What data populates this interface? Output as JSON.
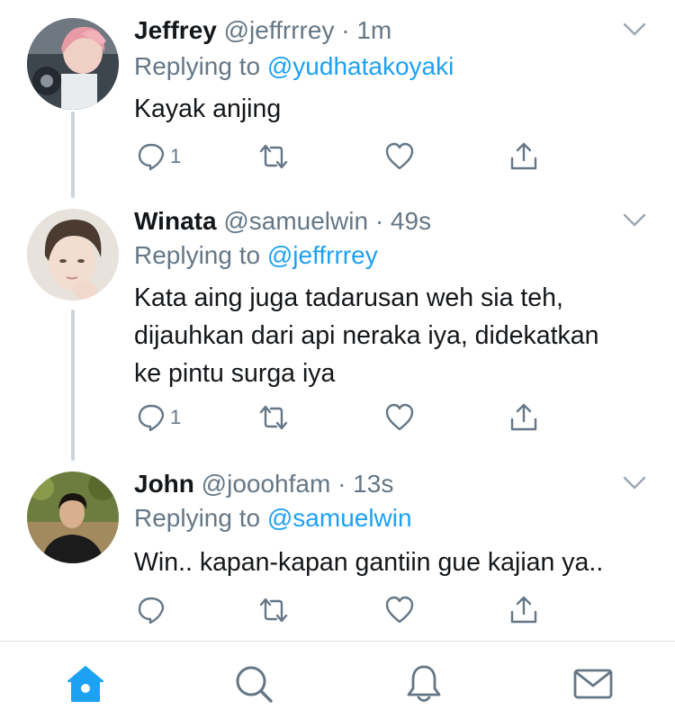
{
  "colors": {
    "accent": "#1da1f2",
    "muted": "#657786",
    "text": "#14171a",
    "thread_line": "#cbd5dc"
  },
  "tweets": [
    {
      "name": "Jeffrey",
      "handle": "@jeffrrrey",
      "separator": "·",
      "time": "1m",
      "replying_prefix": "Replying to",
      "replying_to": "@yudhatakoyaki",
      "text": "Kayak anjing",
      "reply_count": "1",
      "avatar_icon": "user-avatar-pink-hair"
    },
    {
      "name": "Winata",
      "handle": "@samuelwin",
      "separator": "·",
      "time": "49s",
      "replying_prefix": "Replying to",
      "replying_to": "@jeffrrrey",
      "text_lines": [
        "Kata aing juga tadarusan weh sia teh,",
        "dijauhkan dari api neraka iya, didekatkan",
        "ke pintu surga iya"
      ],
      "reply_count": "1",
      "avatar_icon": "user-avatar-portrait"
    },
    {
      "name": "John",
      "handle": "@jooohfam",
      "separator": "·",
      "time": "13s",
      "replying_prefix": "Replying to",
      "replying_to": "@samuelwin",
      "text": "Win.. kapan-kapan gantiin gue kajian ya..",
      "reply_count": "",
      "avatar_icon": "user-avatar-outdoor"
    }
  ],
  "tabbar": {
    "items": [
      {
        "icon": "home-icon",
        "active": true
      },
      {
        "icon": "search-icon",
        "active": false
      },
      {
        "icon": "notifications-icon",
        "active": false
      },
      {
        "icon": "messages-icon",
        "active": false
      }
    ]
  }
}
